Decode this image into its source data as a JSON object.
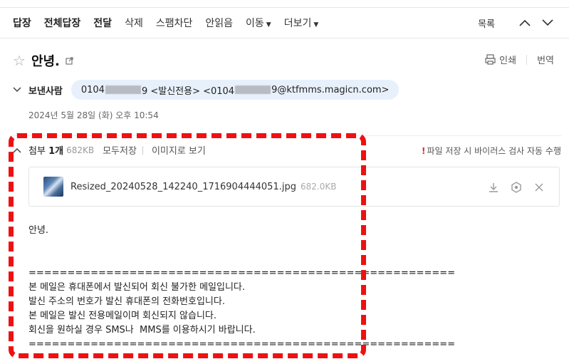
{
  "toolbar": {
    "reply": "답장",
    "reply_all": "전체답장",
    "forward": "전달",
    "delete": "삭제",
    "block_spam": "스팸차단",
    "mark_unread": "안읽음",
    "move": "이동",
    "more": "더보기",
    "list": "목록"
  },
  "mail": {
    "subject": "안녕.",
    "print": "인쇄",
    "translate": "번역",
    "sender_label": "보낸사람",
    "sender_a": "0104",
    "sender_b": "9 <발신전용> <0104",
    "sender_c": "9@ktfmms.magicn.com>",
    "date": "2024년 5월 28일 (화) 오후 10:54"
  },
  "attachments": {
    "label": "첨부",
    "count": "1개",
    "total_size": "682KB",
    "save_all": "모두저장",
    "view_as_image": "이미지로 보기",
    "virus_notice": "파일 저장 시 바이러스 검사 자동 수행",
    "file": {
      "name": "Resized_20240528_142240_1716904444051.jpg",
      "size": "682.0KB"
    }
  },
  "body": {
    "lines": [
      "안녕.",
      "",
      "",
      "=======================================================",
      "본 메일은 휴대폰에서 발신되어 회신 불가한 메일입니다.",
      "발신 주소의 번호가 발신 휴대폰의 전화번호입니다.",
      "본 메일은 발신 전용메일이며 회신되지 않습니다.",
      "회신을 원하실 경우 SMS나  MMS를 이용하시기 바랍니다.",
      "======================================================="
    ]
  },
  "colors": {
    "annotation_red": "#ee1111",
    "chip_bg": "#e8f1fb",
    "warning_red": "#e0242a"
  }
}
